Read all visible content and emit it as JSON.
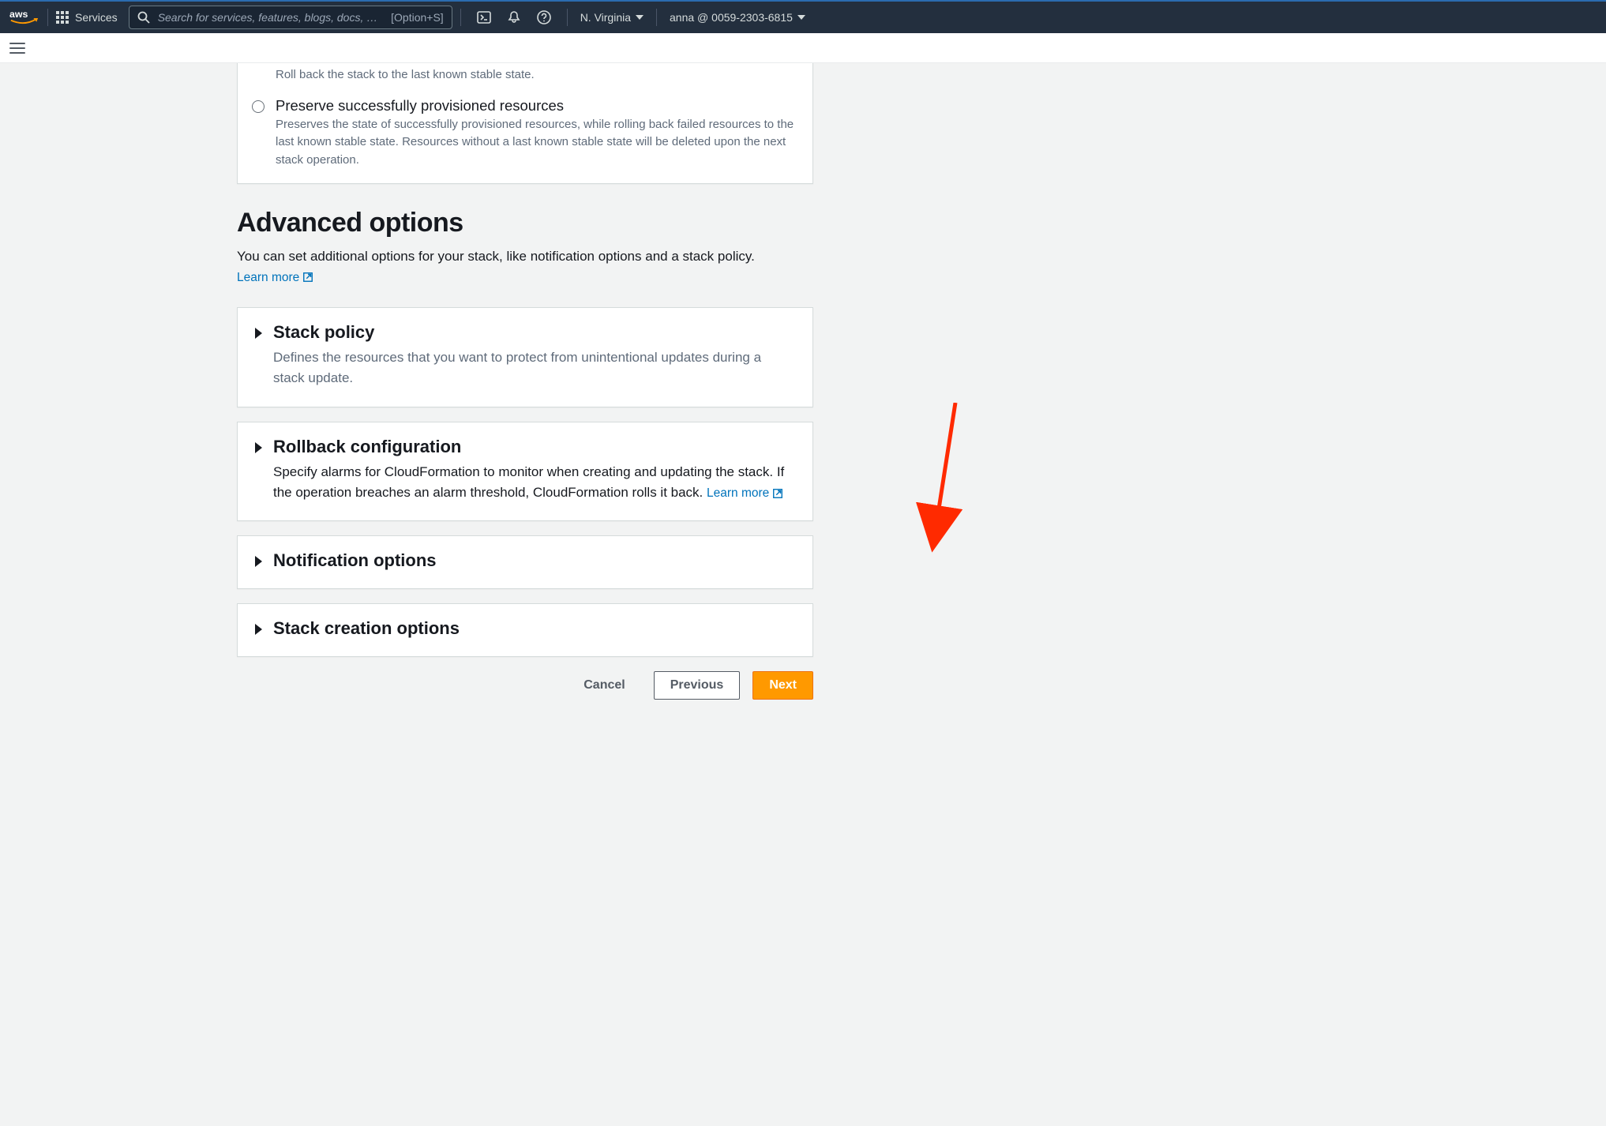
{
  "topnav": {
    "services_label": "Services",
    "search_placeholder": "Search for services, features, blogs, docs, and",
    "search_kbd": "[Option+S]",
    "region": "N. Virginia",
    "account": "anna @ 0059-2303-6815"
  },
  "stack_failure": {
    "rollback_desc": "Roll back the stack to the last known stable state.",
    "preserve_title": "Preserve successfully provisioned resources",
    "preserve_desc": "Preserves the state of successfully provisioned resources, while rolling back failed resources to the last known stable state. Resources without a last known stable state will be deleted upon the next stack operation."
  },
  "advanced": {
    "heading": "Advanced options",
    "desc": "You can set additional options for your stack, like notification options and a stack policy.",
    "learn_more": "Learn more"
  },
  "expanders": {
    "stack_policy": {
      "title": "Stack policy",
      "desc": "Defines the resources that you want to protect from unintentional updates during a stack update."
    },
    "rollback_config": {
      "title": "Rollback configuration",
      "desc": "Specify alarms for CloudFormation to monitor when creating and updating the stack. If the operation breaches an alarm threshold, CloudFormation rolls it back.",
      "learn_more": "Learn more"
    },
    "notification": {
      "title": "Notification options"
    },
    "creation": {
      "title": "Stack creation options"
    }
  },
  "footer": {
    "cancel": "Cancel",
    "previous": "Previous",
    "next": "Next"
  }
}
